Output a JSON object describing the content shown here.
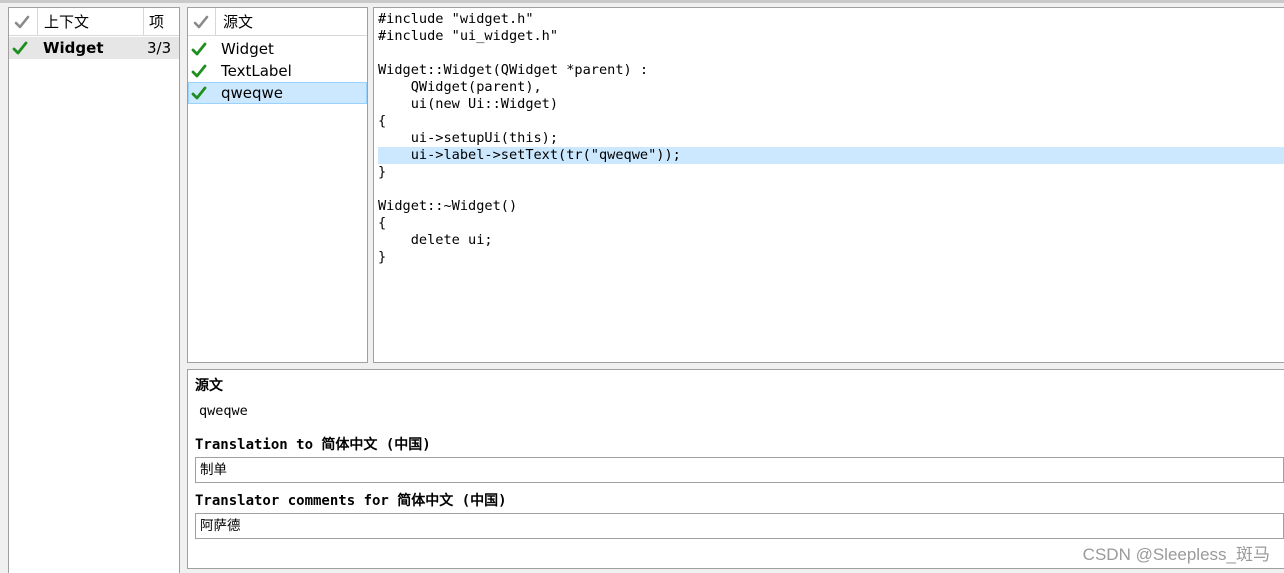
{
  "context": {
    "headers": {
      "context": "上下文",
      "items": "项"
    },
    "rows": [
      {
        "name": "Widget",
        "items": "3/3"
      }
    ]
  },
  "sources": {
    "header": "源文",
    "rows": [
      {
        "text": "Widget"
      },
      {
        "text": "TextLabel"
      },
      {
        "text": "qweqwe"
      }
    ]
  },
  "code": {
    "lines": [
      "#include \"widget.h\"",
      "#include \"ui_widget.h\"",
      "",
      "Widget::Widget(QWidget *parent) :",
      "    QWidget(parent),",
      "    ui(new Ui::Widget)",
      "{",
      "    ui->setupUi(this);",
      "    ui->label->setText(tr(\"qweqwe\"));",
      "}",
      "",
      "Widget::~Widget()",
      "{",
      "    delete ui;",
      "}"
    ]
  },
  "editor": {
    "source_label": "源文",
    "source_text": "qweqwe",
    "translation_label": "Translation to 简体中文 (中国)",
    "translation_value": "制单",
    "comments_label": "Translator comments for 简体中文 (中国)",
    "comments_value": "阿萨德"
  },
  "watermark": "CSDN @Sleepless_斑马",
  "colors": {
    "selection": "#cce8ff",
    "check_green": "#1e8e1e",
    "check_gray": "#8a8a8a"
  }
}
